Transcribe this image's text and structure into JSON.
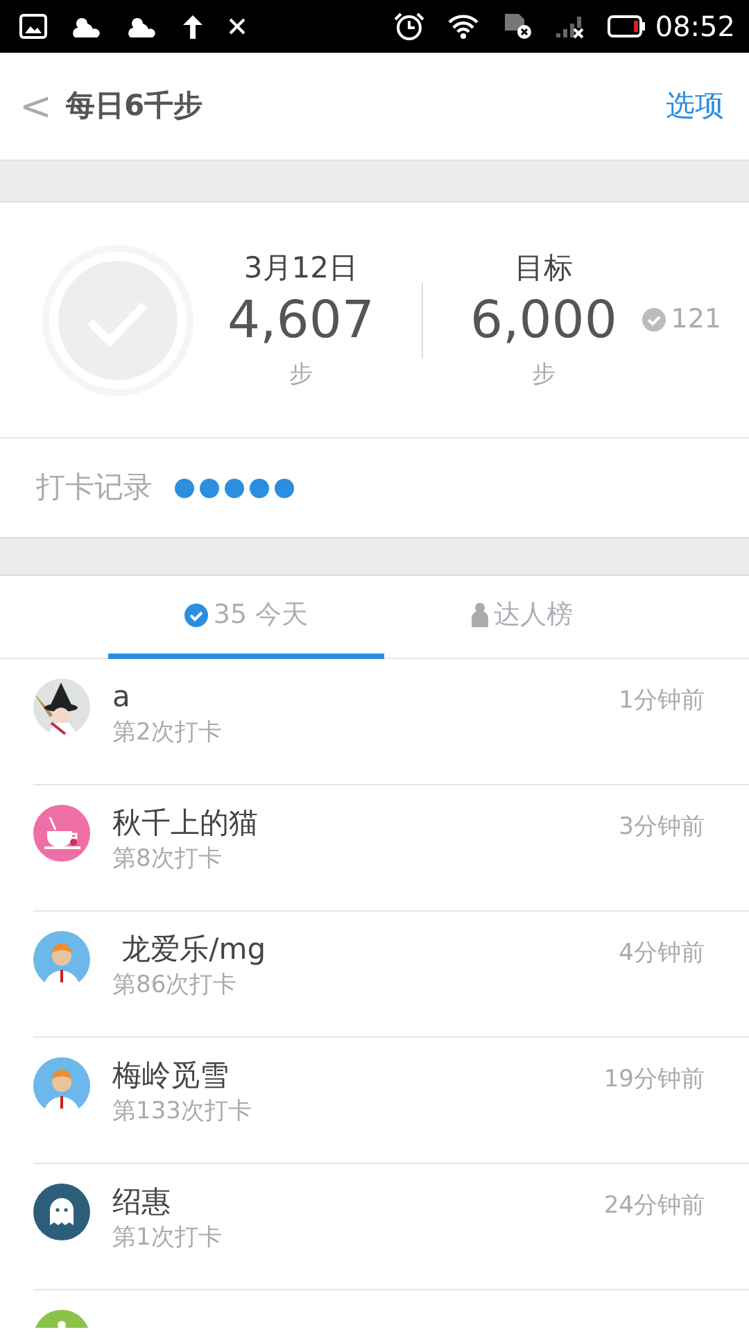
{
  "status_bar": {
    "time": "08:52"
  },
  "header": {
    "back": "<",
    "title": "每日6千步",
    "action": "选项"
  },
  "summary": {
    "checked_in": false,
    "date": "3月12日",
    "steps": "4,607",
    "steps_unit": "步",
    "goal_label": "目标",
    "goal": "6,000",
    "goal_unit": "步",
    "checkins": "121"
  },
  "record": {
    "label": "打卡记录",
    "dots": [
      {
        "color": "#2b8ede"
      },
      {
        "color": "#2b8ede"
      },
      {
        "color": "#2b8ede"
      },
      {
        "color": "#2b8ede"
      },
      {
        "color": "#2b8ede"
      }
    ]
  },
  "tabs": [
    {
      "kind": "check",
      "count": "35",
      "label": "今天",
      "selected": true
    },
    {
      "kind": "person",
      "label": "达人榜",
      "selected": false
    }
  ],
  "rows": [
    {
      "name": "a",
      "count": "第2次打卡",
      "time": "1分钟前"
    },
    {
      "kind": "cup",
      "name": "秋千上的猫",
      "count": "第8次打卡",
      "time": "3分钟前"
    },
    {
      "kind": "person",
      "name": " 龙爱乐/mg",
      "count": "第86次打卡",
      "time": "4分钟前"
    },
    {
      "kind": "person",
      "name": "梅岭觅雪",
      "count": "第133次打卡",
      "time": "19分钟前"
    },
    {
      "kind": "ghost",
      "name": "绍惠",
      "count": "第1次打卡",
      "time": "24分钟前"
    },
    {
      "kind": "green"
    }
  ]
}
